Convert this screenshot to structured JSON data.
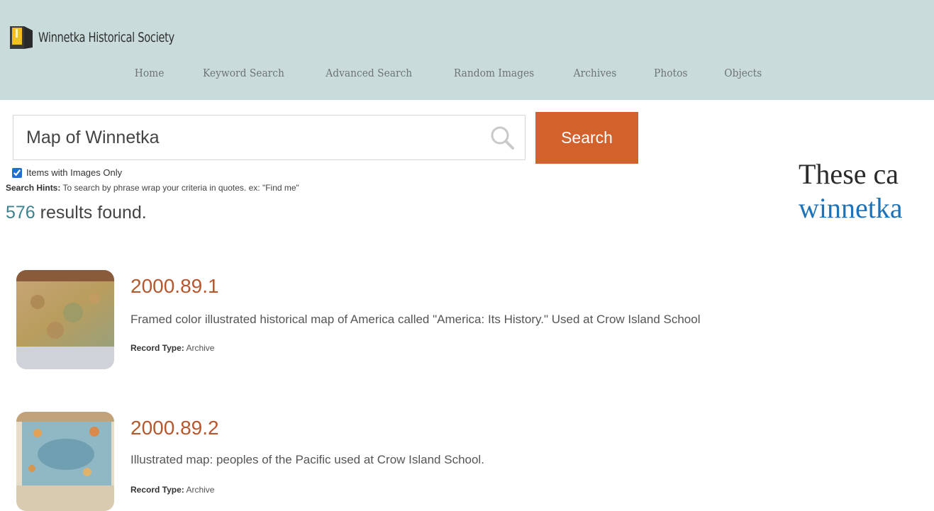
{
  "header": {
    "site_name": "Winnetka Historical Society",
    "icons": {
      "logo": "door-logo-icon"
    },
    "nav": [
      "Home",
      "Keyword Search",
      "Advanced Search",
      "Random Images",
      "Archives",
      "Photos",
      "Objects"
    ]
  },
  "search": {
    "value": "Map of Winnetka",
    "button_label": "Search",
    "icons": {
      "search": "magnifier-icon"
    },
    "images_only_label": "Items with Images Only",
    "images_only_checked": true,
    "hints_label": "Search Hints:",
    "hints_text": " To search by phrase wrap your criteria in quotes. ex: \"Find me\""
  },
  "results": {
    "count": "576",
    "count_suffix": " results found.",
    "items": [
      {
        "id": "2000.89.1",
        "description": "Framed color illustrated historical map of America called \"America: Its History.\" Used at Crow Island School",
        "record_type_label": "Record Type:",
        "record_type": " Archive"
      },
      {
        "id": "2000.89.2",
        "description": "Illustrated map: peoples of the Pacific used at Crow Island School.",
        "record_type_label": "Record Type:",
        "record_type": " Archive"
      }
    ]
  },
  "aside": {
    "line1": "These ca",
    "line2": "winnetka"
  },
  "colors": {
    "header_bg": "#c9dcdb",
    "button_bg": "#d3612c",
    "title_color": "#b5582f",
    "count_color": "#3c8291",
    "link_color": "#1e73b8"
  }
}
